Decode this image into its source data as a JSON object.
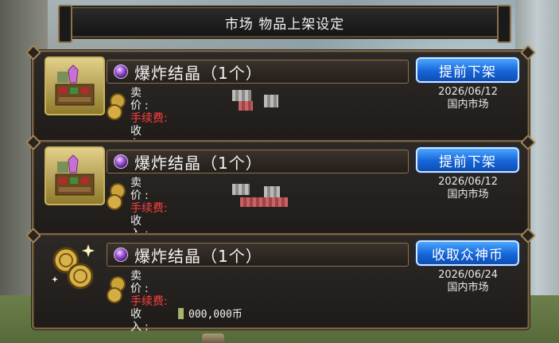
{
  "title": "市场 物品上架设定",
  "listings": [
    {
      "item_name": "爆炸结晶（1个）",
      "action_label": "提前下架",
      "labels": {
        "price": "卖　价:",
        "fee": "手续费:",
        "income": "收　入:"
      },
      "income_value": "",
      "date": "2026/06/12",
      "market": "国内市场",
      "icon": "merchant-stall-icon"
    },
    {
      "item_name": "爆炸结晶（1个）",
      "action_label": "提前下架",
      "labels": {
        "price": "卖　价:",
        "fee": "手续费:",
        "income": "收　入:"
      },
      "income_value": "",
      "date": "2026/06/12",
      "market": "国内市场",
      "icon": "merchant-stall-icon"
    },
    {
      "item_name": "爆炸结晶（1个）",
      "action_label": "收取众神币",
      "labels": {
        "price": "卖　价:",
        "fee": "手续费:",
        "income": "收　入:"
      },
      "income_value": "000,000币",
      "date": "2026/06/24",
      "market": "国内市场",
      "icon": "god-coin-icon"
    }
  ],
  "colors": {
    "button_blue": "#1665d8",
    "fee_red": "#ff4040",
    "panel_border": "#7b6444"
  }
}
